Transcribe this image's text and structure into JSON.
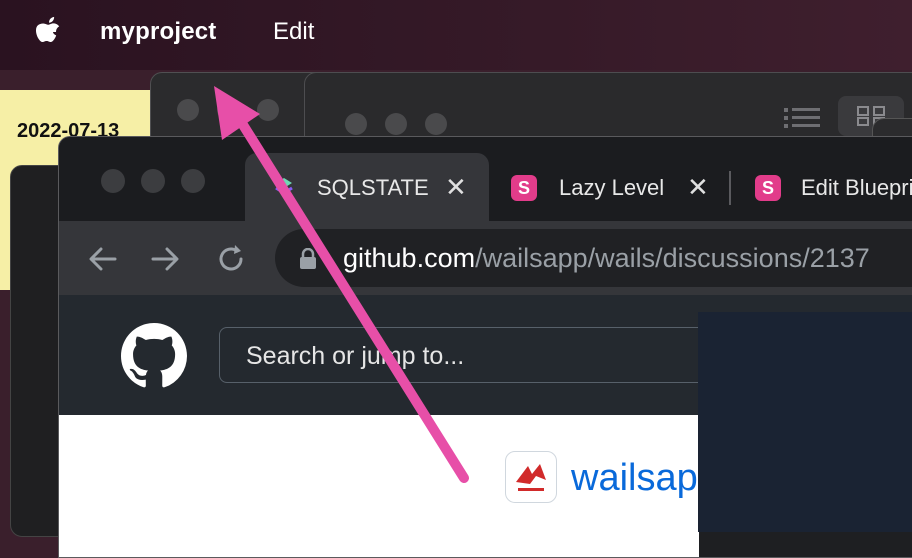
{
  "menubar": {
    "app_name": "myproject",
    "edit_label": "Edit"
  },
  "sticky_note": {
    "date_text": "2022-07-13"
  },
  "browser": {
    "tabs": [
      {
        "title": "SQLSTATE",
        "icon": "sqlstate-favicon",
        "close": "✕"
      },
      {
        "title": "Lazy Level",
        "icon": "s-favicon",
        "close": "✕"
      },
      {
        "title": "Edit Blueprint",
        "icon": "s-favicon"
      }
    ],
    "url": {
      "host": "github.com",
      "path": "/wailsapp/wails/discussions/2137"
    },
    "github": {
      "search_placeholder": "Search or jump to...",
      "org_name": "wailsapp"
    }
  },
  "colors": {
    "annotation_arrow": "#e74fa8",
    "link": "#0969da"
  }
}
